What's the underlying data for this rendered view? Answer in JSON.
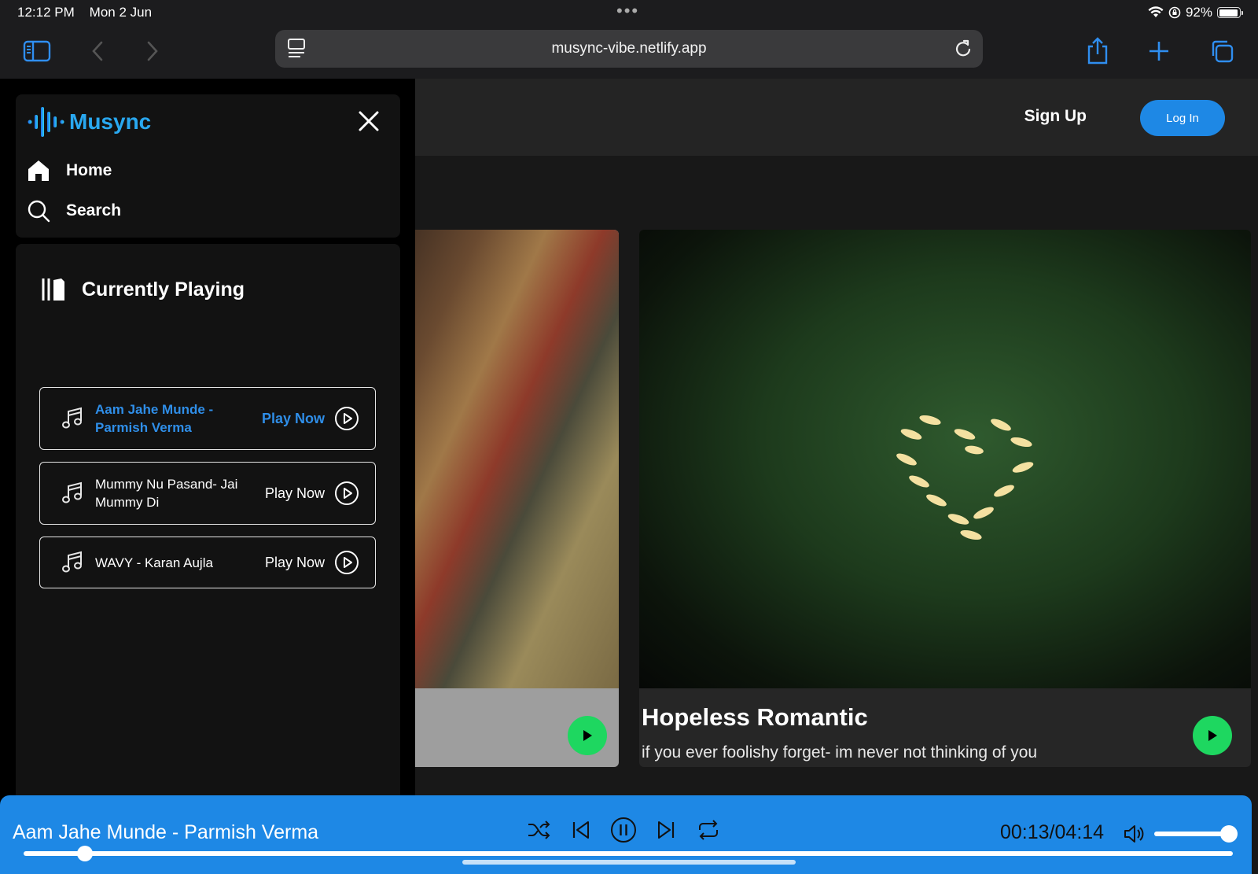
{
  "status_bar": {
    "time": "12:12 PM",
    "date": "Mon 2 Jun",
    "battery": "92%",
    "battery_level": 0.92,
    "icons": [
      "wifi-icon",
      "orientation-lock-icon",
      "battery-icon"
    ]
  },
  "browser": {
    "url": "musync-vibe.netlify.app",
    "icons": [
      "sidebar-toggle-icon",
      "back-icon",
      "forward-icon",
      "reader-icon",
      "reload-icon",
      "share-icon",
      "new-tab-icon",
      "tabs-icon"
    ]
  },
  "header": {
    "signup_label": "Sign Up",
    "login_label": "Log In"
  },
  "sidebar": {
    "logo_text": "Musync",
    "nav": [
      {
        "label": "Home",
        "icon": "home-icon"
      },
      {
        "label": "Search",
        "icon": "search-icon"
      }
    ],
    "currently_playing_label": "Currently Playing",
    "songs": [
      {
        "title": "Aam Jahe Munde - Parmish Verma",
        "action": "Play Now",
        "active": true
      },
      {
        "title": "Mummy Nu Pasand- Jai Mummy Di",
        "action": "Play Now",
        "active": false
      },
      {
        "title": "WAVY - Karan Aujla",
        "action": "Play Now",
        "active": false
      }
    ]
  },
  "cards": [
    {
      "title": "",
      "subtitle": ""
    },
    {
      "title": "Hopeless Romantic",
      "subtitle": "if you ever foolishy forget- im never not thinking of you"
    }
  ],
  "player": {
    "now_playing": "Aam Jahe Munde - Parmish Verma",
    "time": "00:13/04:14",
    "progress": 0.051,
    "volume": 0.95,
    "controls": [
      "shuffle-icon",
      "previous-icon",
      "pause-icon",
      "next-icon",
      "repeat-icon"
    ]
  },
  "colors": {
    "accent": "#1e88e5",
    "logo": "#29a8f0",
    "play_button": "#1ed760",
    "active_song": "#2f8ee8"
  }
}
